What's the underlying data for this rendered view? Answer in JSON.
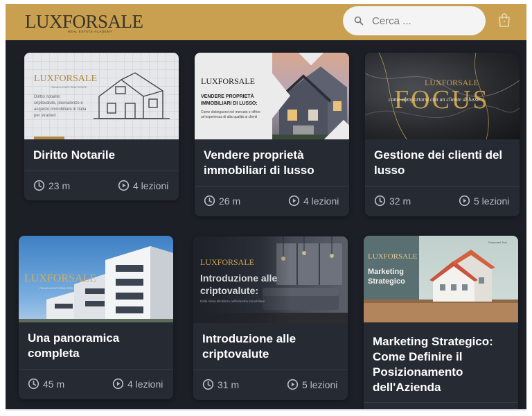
{
  "header": {
    "logo_main": "LUXFORSALE",
    "logo_sub": "REAL ESTATE ACADEMY",
    "search_placeholder": "Cerca ..."
  },
  "colors": {
    "header": "#c9a050",
    "background": "#1c1f26",
    "card": "#262a33"
  },
  "courses": [
    {
      "title": "Diritto Notarile",
      "duration": "23 m",
      "lessons": "4 lezioni",
      "thumb": {
        "brand": "LUXFORSALE",
        "brand_sub": "ITALIAN LUXURY REAL ESTATE",
        "text": [
          "Diritto notarile:",
          "criptovaluto, plusvalenzo e",
          "acquisto immobiliare in Italia",
          "per stranieri"
        ]
      }
    },
    {
      "title": "Vendere proprietà immobiliari di lusso",
      "duration": "26 m",
      "lessons": "4 lezioni",
      "thumb": {
        "brand": "LUXFORSALE",
        "heading": [
          "VENDERE PROPRIETÀ",
          "IMMOBILIARI DI LUSSO:"
        ],
        "text": [
          "Come distinguersi nel mercato e offrire",
          "un'esperienza di alta qualità ai clienti"
        ]
      }
    },
    {
      "title": "Gestione dei clienti del lusso",
      "duration": "32 m",
      "lessons": "5 lezioni",
      "thumb": {
        "brand": "LUXFORSALE",
        "heading": "FOCUS",
        "script": "come comportarsi con un cliente di lusso"
      }
    },
    {
      "title": "Una panoramica completa",
      "duration": "45 m",
      "lessons": "4 lezioni",
      "thumb": {
        "brand": "LUXFORSALE",
        "brand_sub": "ITALIAN LUXURY REAL ESTATE"
      }
    },
    {
      "title": "Introduzione alle criptovalute",
      "duration": "31 m",
      "lessons": "5 lezioni",
      "thumb": {
        "brand": "LUXFORSALE",
        "heading": [
          "Introduzione alle",
          "criptovalute:"
        ],
        "text": "Dalla storia all'utilizzo nell'industria immobiliare"
      }
    },
    {
      "title": "Marketing Strategico: Come Definire il Posizionamento dell'Azienda",
      "duration": "",
      "lessons": "",
      "thumb": {
        "brand": "LUXFORSALE",
        "heading": [
          "Marketing",
          "Strategico"
        ],
        "corner": "Presented Test"
      }
    }
  ]
}
